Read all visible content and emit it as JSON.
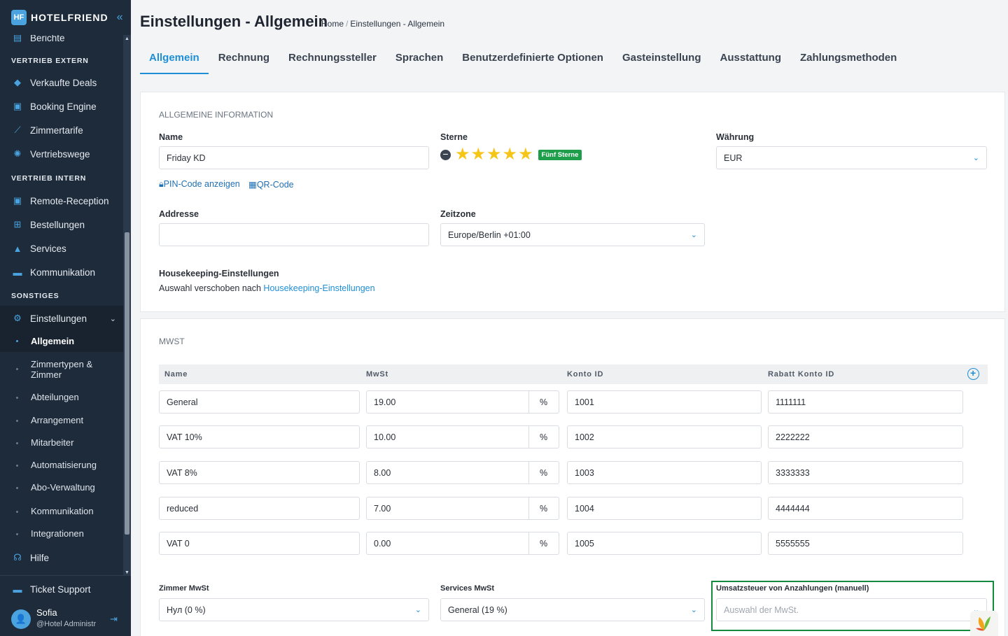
{
  "brand": {
    "name": "HOTELFRIEND",
    "mark": "HF"
  },
  "sidebar": {
    "partial_top_item": "Berichte",
    "sections": {
      "extern": "VERTRIEB EXTERN",
      "intern": "VERTRIEB INTERN",
      "sonstiges": "SONSTIGES"
    },
    "extern_items": [
      "Verkaufte Deals",
      "Booking Engine",
      "Zimmertarife",
      "Vertriebswege"
    ],
    "intern_items": [
      "Remote-Reception",
      "Bestellungen",
      "Services",
      "Kommunikation"
    ],
    "settings": "Einstellungen",
    "settings_sub": [
      "Allgemein",
      "Zimmertypen &",
      "Zimmer",
      "Abteilungen",
      "Arrangement",
      "Mitarbeiter",
      "Automatisierung",
      "Abo-Verwaltung",
      "Kommunikation",
      "Integrationen"
    ],
    "help": "Hilfe",
    "ticket": "Ticket Support",
    "user": {
      "name": "Sofia",
      "role": "@Hotel Administr"
    }
  },
  "header": {
    "title": "Einstellungen - Allgemein",
    "breadcrumb": [
      "Home",
      "Einstellungen - Allgemein"
    ]
  },
  "tabs": [
    "Allgemein",
    "Rechnung",
    "Rechnungssteller",
    "Sprachen",
    "Benutzerdefinierte Optionen",
    "Gasteinstellung",
    "Ausstattung",
    "Zahlungsmethoden"
  ],
  "general": {
    "section_title": "ALLGEMEINE INFORMATION",
    "name_label": "Name",
    "name_value": "Friday KD",
    "stars_label": "Sterne",
    "stars_value": 5,
    "stars_badge": "Fünf Sterne",
    "currency_label": "Währung",
    "currency_value": "EUR",
    "pin_link": "PIN-Code anzeigen",
    "qr_link": "QR-Code",
    "address_label": "Addresse",
    "address_value": "",
    "timezone_label": "Zeitzone",
    "timezone_value": "Europe/Berlin +01:00",
    "housekeeping_label": "Housekeeping-Einstellungen",
    "housekeeping_text": "Auswahl verschoben nach",
    "housekeeping_link": "Housekeeping-Einstellungen"
  },
  "vat": {
    "section_title": "MWST",
    "headers": [
      "Name",
      "MwSt",
      "Konto ID",
      "Rabatt Konto ID"
    ],
    "percent_symbol": "%",
    "rows": [
      {
        "name": "General",
        "rate": "19.00",
        "konto": "1001",
        "rabatt": "1111111"
      },
      {
        "name": "VAT 10%",
        "rate": "10.00",
        "konto": "1002",
        "rabatt": "2222222"
      },
      {
        "name": "VAT 8%",
        "rate": "8.00",
        "konto": "1003",
        "rabatt": "3333333"
      },
      {
        "name": "reduced",
        "rate": "7.00",
        "konto": "1004",
        "rabatt": "4444444"
      },
      {
        "name": "VAT 0",
        "rate": "0.00",
        "konto": "1005",
        "rabatt": "5555555"
      }
    ],
    "room_vat_label": "Zimmer MwSt",
    "room_vat_value": "Нул (0 %)",
    "services_vat_label": "Services MwSt",
    "services_vat_value": "General (19 %)",
    "deposit_vat_label": "Umsatzsteuer von Anzahlungen (manuell)",
    "deposit_vat_placeholder": "Auswahl der MwSt."
  },
  "colors": {
    "accent": "#1e8fd6",
    "sidebar": "#1e2b3b",
    "star": "#f5c518",
    "badge": "#1e9e4a",
    "highlight": "#138a3d"
  }
}
